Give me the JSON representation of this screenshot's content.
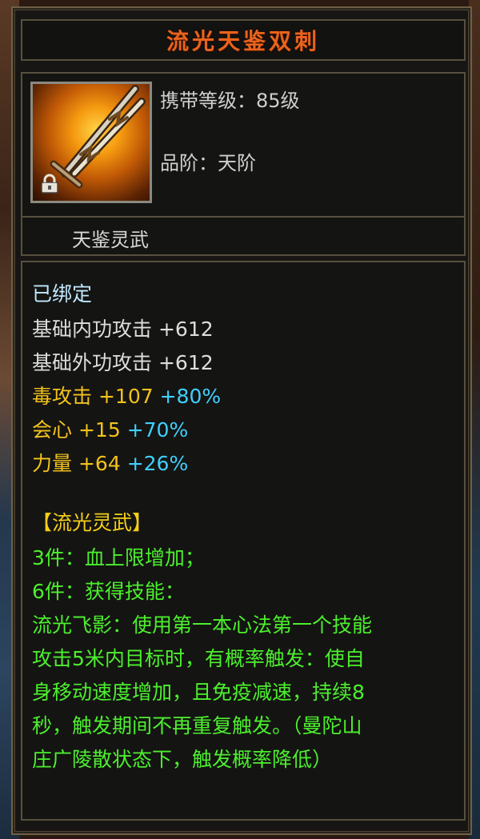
{
  "item": {
    "name": "流光天鉴双刺",
    "carry_level": "携带等级：85级",
    "quality": "品阶：天阶",
    "subtype": "天鉴灵武"
  },
  "icon": {
    "name": "dual-daggers-icon",
    "lock": "lock-icon"
  },
  "stats": {
    "bound": "已绑定",
    "inner_attack": {
      "label": "基础内功攻击",
      "value": "+612"
    },
    "outer_attack": {
      "label": "基础外功攻击",
      "value": "+612"
    },
    "poison": {
      "label": "毒攻击",
      "value": "+107",
      "bonus": "+80%"
    },
    "crit": {
      "label": "会心",
      "value": "+15",
      "bonus": "+70%"
    },
    "strength": {
      "label": "力量",
      "value": "+64",
      "bonus": "+26%"
    }
  },
  "set": {
    "title": "【流光灵武】",
    "lines": [
      "3件：血上限增加；",
      "6件：获得技能：",
      "流光飞影：使用第一本心法第一个技能",
      "攻击5米内目标时，有概率触发：使自",
      "身移动速度增加，且免疫减速，持续8",
      "秒，触发期间不再重复触发。（曼陀山",
      "庄广陵散状态下，触发概率降低）"
    ]
  },
  "colors": {
    "title": "#e9631d",
    "bound": "#bfe8ff",
    "base_stat": "#dedede",
    "yellow_stat": "#f2c21c",
    "bonus": "#3fd0ff",
    "set_text": "#4cef2e",
    "set_title": "#f4ce18"
  }
}
